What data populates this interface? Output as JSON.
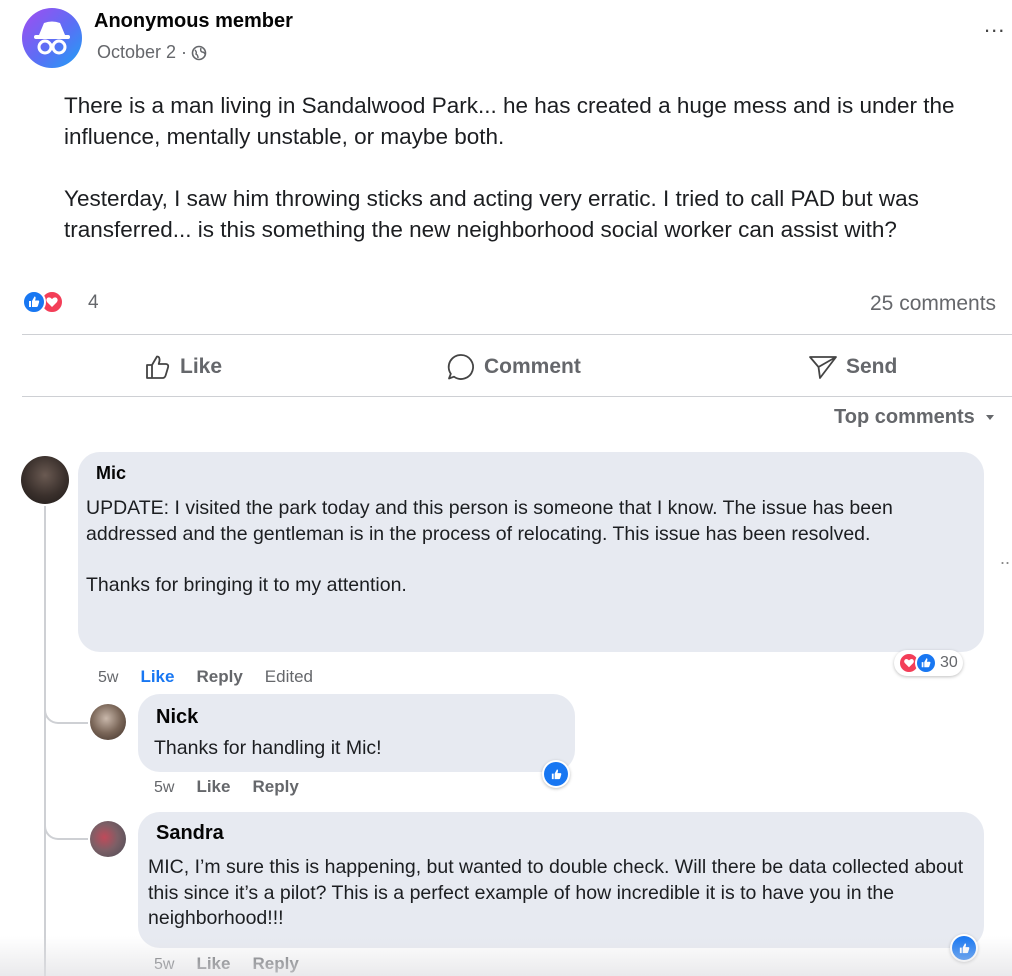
{
  "post": {
    "author": "Anonymous member",
    "date": "October 2 ·",
    "audience_icon": "globe-icon",
    "more_label": "...",
    "body": "There is a man living in Sandalwood Park... he has created a huge mess and is under the influence, mentally unstable, or maybe both.\n\nYesterday, I saw him throwing sticks and acting very erratic. I tried to call PAD but was transferred... is this something the new neighborhood  social worker can assist with?",
    "reaction_count": "4",
    "reaction_icons": [
      "like-icon",
      "love-icon"
    ],
    "comments_count": "25 comments"
  },
  "actions": {
    "like": "Like",
    "comment": "Comment",
    "send": "Send"
  },
  "sort_label": "Top comments",
  "comments": [
    {
      "name": "Mic",
      "text": "UPDATE: I visited the park today and this person is someone that I know. The issue has been addressed and the gentleman is in the process of relocating. This issue has been resolved.\n\nThanks for bringing it to my attention.",
      "time": "5w",
      "like": "Like",
      "reply": "Reply",
      "edited": "Edited",
      "reaction_count": "30",
      "more_label": ".."
    },
    {
      "name": "Nick",
      "text": "Thanks for handling it Mic!",
      "time": "5w",
      "like": "Like",
      "reply": "Reply"
    },
    {
      "name": "Sandra",
      "text": "MIC, I’m sure this is happening, but wanted to double check. Will there be data collected about this since it’s a pilot? This is a perfect example of how incredible it is to have you in the neighborhood!!!",
      "time": "5w",
      "like": "Like",
      "reply": "Reply"
    }
  ],
  "colors": {
    "accent": "#1877f2",
    "love": "#f33e58",
    "bubble": "#e7eaf1",
    "muted": "#65676b"
  }
}
